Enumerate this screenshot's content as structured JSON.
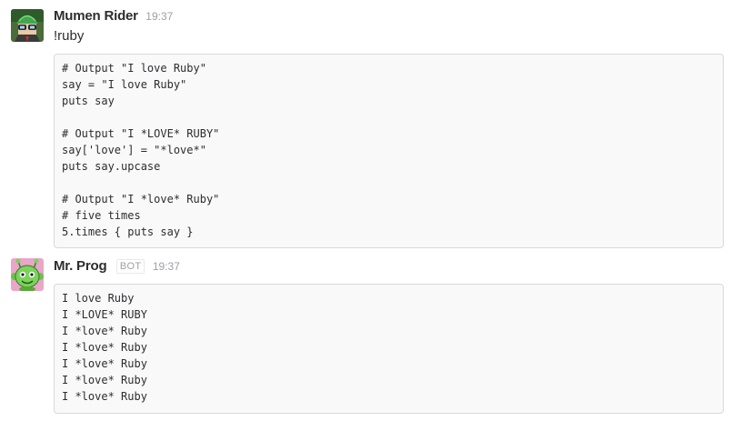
{
  "messages": [
    {
      "sender": "Mumen Rider",
      "timestamp": "19:37",
      "avatar": "mumen-rider-avatar",
      "text": "!ruby",
      "code_lines": [
        "# Output \"I love Ruby\"",
        "say = \"I love Ruby\"",
        "puts say",
        "",
        "# Output \"I *LOVE* RUBY\"",
        "say['love'] = \"*love*\"",
        "puts say.upcase",
        "",
        "# Output \"I *love* Ruby\"",
        "# five times",
        "5.times { puts say }"
      ]
    },
    {
      "sender": "Mr. Prog",
      "badge": "BOT",
      "timestamp": "19:37",
      "avatar": "mr-prog-avatar",
      "code_lines": [
        "I love Ruby",
        "I *LOVE* RUBY",
        "I *love* Ruby",
        "I *love* Ruby",
        "I *love* Ruby",
        "I *love* Ruby",
        "I *love* Ruby"
      ]
    }
  ],
  "colors": {
    "text": "#2c2d30",
    "timestamp": "#9e9ea6",
    "code_background": "#f9f9f9",
    "code_border": "#d9d9d9"
  }
}
